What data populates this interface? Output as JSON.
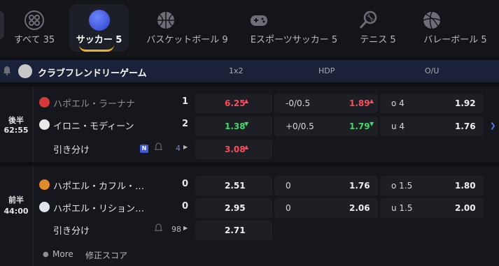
{
  "tabs": [
    {
      "label": "すべて 35",
      "icon": "grid-icon"
    },
    {
      "label": "サッカー 5",
      "icon": "soccer-ball-icon"
    },
    {
      "label": "バスケットボール 9",
      "icon": "basketball-icon"
    },
    {
      "label": "Eスポーツサッカー 5",
      "icon": "gamepad-icon"
    },
    {
      "label": "テニス 5",
      "icon": "tennis-racket-icon"
    },
    {
      "label": "バレーボール 5",
      "icon": "volleyball-icon"
    }
  ],
  "league": {
    "name": "クラブフレンドリーゲーム",
    "col_1x2": "1x2",
    "col_hdp": "HDP",
    "col_ou": "O/U"
  },
  "matches": [
    {
      "period": "後半",
      "clock": "62:55",
      "home": {
        "name": "ハポエル・ラーナナ",
        "score": "1"
      },
      "away": {
        "name": "イロニ・モディーン",
        "score": "2"
      },
      "draw_label": "引き分け",
      "badge": "N",
      "more_count": "4",
      "odds_1x2": {
        "home": "6.25",
        "away": "1.38",
        "draw": "3.08"
      },
      "hdp": {
        "home_line": "-0/0.5",
        "home_odd": "1.89",
        "away_line": "+0/0.5",
        "away_odd": "1.79"
      },
      "ou": {
        "over_line": "o 4",
        "over_odd": "1.92",
        "under_line": "u 4",
        "under_odd": "1.76"
      }
    },
    {
      "period": "前半",
      "clock": "44:00",
      "home": {
        "name": "ハポエル・カフル・…",
        "score": "0"
      },
      "away": {
        "name": "ハポエル・リション…",
        "score": "0"
      },
      "draw_label": "引き分け",
      "more_count": "98",
      "odds_1x2": {
        "home": "2.51",
        "away": "2.95",
        "draw": "2.71"
      },
      "hdp": {
        "home_line": "0",
        "home_odd": "1.76",
        "away_line": "0",
        "away_odd": "2.06"
      },
      "ou": {
        "over_line": "o 1.5",
        "over_odd": "1.80",
        "under_line": "u 1.5",
        "under_odd": "2.00"
      },
      "more_label": "More",
      "correct_score_label": "修正スコア"
    }
  ],
  "colors": {
    "up": "#ff4a5c",
    "down": "#41d96b",
    "accent": "#3f5bd9",
    "highlight": "#f0b020"
  }
}
